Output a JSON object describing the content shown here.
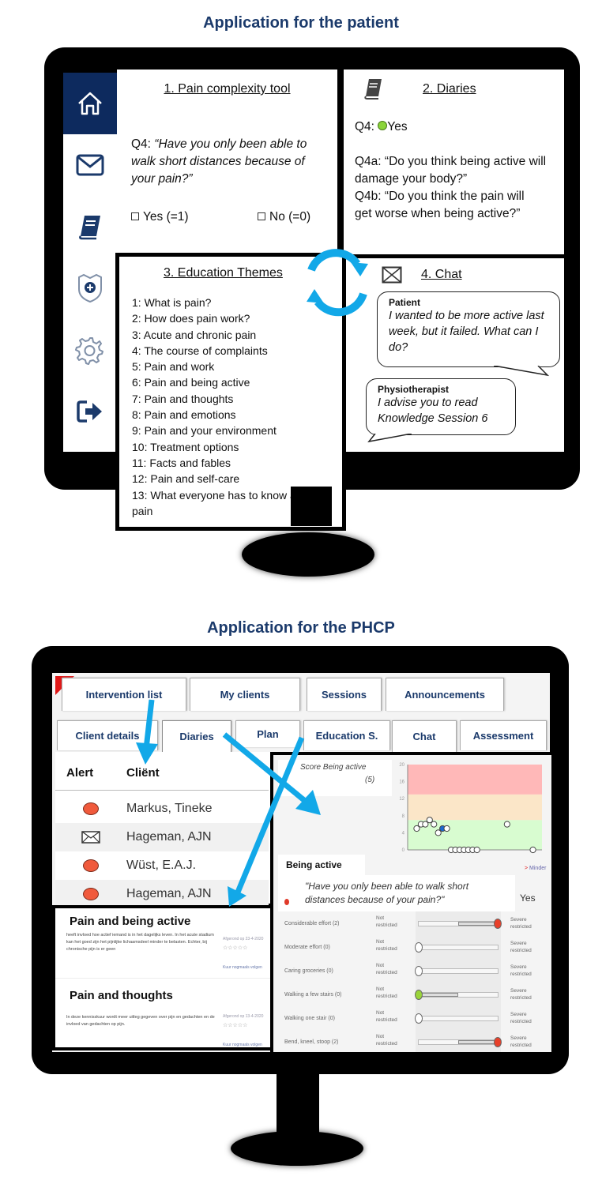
{
  "titles": {
    "patient": "Application for the patient",
    "phcp": "Application for the PHCP"
  },
  "patient_app": {
    "sidebar": [
      {
        "icon": "home-icon",
        "active": true
      },
      {
        "icon": "mail-icon",
        "active": false
      },
      {
        "icon": "diary-book-icon",
        "active": false
      },
      {
        "icon": "shield-plus-icon",
        "active": false
      },
      {
        "icon": "gear-icon",
        "active": false
      },
      {
        "icon": "logout-icon",
        "active": false
      }
    ],
    "pain_tool": {
      "title": "1. Pain complexity tool",
      "question_prefix": "Q4: ",
      "question": "“Have you only been able to walk short distances because of your pain?”",
      "option_yes": "Yes (=1)",
      "option_no": "No (=0)"
    },
    "diaries": {
      "title": "2. Diaries",
      "q4_label": "Q4:",
      "q4_answer": "Yes",
      "q4a": "Q4a: “Do you think being active will damage your body?”",
      "q4b": "Q4b: “Do you think the pain will get worse when being active?”",
      "answer_color": "#8bd43a"
    },
    "education": {
      "title": "3. Education Themes",
      "themes": [
        "1: What is pain?",
        "2: How does pain work?",
        "3: Acute and chronic pain",
        "4: The course of complaints",
        "5: Pain and work",
        "6: Pain and being active",
        "7: Pain and thoughts",
        "8: Pain and emotions",
        "9: Pain and your environment",
        "10: Treatment options",
        "11: Facts and fables",
        "12: Pain and self-care",
        "13: What everyone has to know about pain"
      ]
    },
    "chat": {
      "title": "4. Chat",
      "messages": [
        {
          "sender": "Patient",
          "text": "I wanted to be more active last week, but it failed. What can I do?"
        },
        {
          "sender": "Physiotherapist",
          "text": "I advise you to read Knowledge Session 6"
        }
      ]
    }
  },
  "phcp_app": {
    "main_tabs": [
      "Intervention list",
      "My clients",
      "Sessions",
      "Announcements"
    ],
    "sub_tabs": [
      "Client details",
      "Diaries",
      "Plan",
      "Education S.",
      "Chat",
      "Assessment"
    ],
    "client_table": {
      "headers": [
        "Alert",
        "Cliënt"
      ],
      "rows": [
        {
          "alert": "red-dot",
          "client": "Markus, Tineke"
        },
        {
          "alert": "mail",
          "client": "Hageman, AJN"
        },
        {
          "alert": "red-dot",
          "client": "Wüst, E.A.J."
        },
        {
          "alert": "red-dot",
          "client": "Hageman, AJN"
        }
      ]
    },
    "articles": [
      {
        "title": "Pain and being active",
        "text": "heeft invloed hoe actief iemand is in het dagelijks leven. In het acute stadium kan het goed zijn het pijnlijke lichaamsdeel minder te belasten. Echter, bij chronische pijn is er geen",
        "meta": "Afgerond op 23-4-2020",
        "rating": "☆☆☆☆☆",
        "link": "Kuur nogmaals volgen"
      },
      {
        "title": "Pain and thoughts",
        "text": "In deze kennisskuur wordt meer uitleg gegeven over pijn en gedachten en de invloed van gedachten op pijn.",
        "meta": "Afgerond op 13-4-2020",
        "rating": "☆☆☆☆☆",
        "link": "Kuur nogmaals volgen"
      }
    ],
    "diary_detail": {
      "score_label": "Score Being active",
      "score_value": "(5)",
      "section_title": "Being active",
      "link_more": "Minder",
      "question": "\"Have you only been able to walk short distances because of your pain?\"",
      "answer": "Yes",
      "sliders": [
        {
          "label": "Considerable effort (2)",
          "left": "Not restricted",
          "right": "Severe restricted",
          "value": 1.0,
          "knob": "red"
        },
        {
          "label": "Moderate effort (0)",
          "left": "Not restricted",
          "right": "Severe restricted",
          "value": 0.0,
          "knob": "white"
        },
        {
          "label": "Caring groceries (0)",
          "left": "Not restricted",
          "right": "Severe restricted",
          "value": 0.0,
          "knob": "white"
        },
        {
          "label": "Walking a few stairs (0)",
          "left": "Not restricted",
          "right": "Severe restricted",
          "value": 0.0,
          "knob": "green"
        },
        {
          "label": "Walking one stair (0)",
          "left": "Not restricted",
          "right": "Severe restricted",
          "value": 0.0,
          "knob": "white"
        },
        {
          "label": "Bend, kneel, stoop (2)",
          "left": "Not restricted",
          "right": "Severe restricted",
          "value": 1.0,
          "knob": "red"
        }
      ]
    }
  },
  "chart_data": {
    "type": "scatter",
    "title": "Score Being active (5)",
    "xlabel": "",
    "ylabel": "",
    "ylim": [
      0,
      20
    ],
    "yticks": [
      "0",
      "4",
      "8",
      "12",
      "16",
      "20"
    ],
    "bands": [
      {
        "from": 0,
        "to": 7,
        "color": "#d8fcd0"
      },
      {
        "from": 7,
        "to": 13,
        "color": "#fbe6c8"
      },
      {
        "from": 13,
        "to": 20,
        "color": "#ffb8b8"
      }
    ],
    "points": [
      {
        "x": 1,
        "y": 5
      },
      {
        "x": 2,
        "y": 6
      },
      {
        "x": 3,
        "y": 6
      },
      {
        "x": 4,
        "y": 7
      },
      {
        "x": 5,
        "y": 6
      },
      {
        "x": 6,
        "y": 4
      },
      {
        "x": 7,
        "y": 5,
        "highlight": true
      },
      {
        "x": 8,
        "y": 5
      },
      {
        "x": 9,
        "y": 0
      },
      {
        "x": 10,
        "y": 0
      },
      {
        "x": 11,
        "y": 0
      },
      {
        "x": 12,
        "y": 0
      },
      {
        "x": 13,
        "y": 0
      },
      {
        "x": 14,
        "y": 0
      },
      {
        "x": 15,
        "y": 0
      },
      {
        "x": 22,
        "y": 6
      },
      {
        "x": 28,
        "y": 0
      }
    ],
    "xlim": [
      0,
      29
    ],
    "grid": false,
    "legend": "none"
  },
  "colors": {
    "title": "#1b3a6b",
    "nav_active": "#0d2a5e",
    "arrow": "#12a8e8",
    "alert": "#f05a3c"
  }
}
